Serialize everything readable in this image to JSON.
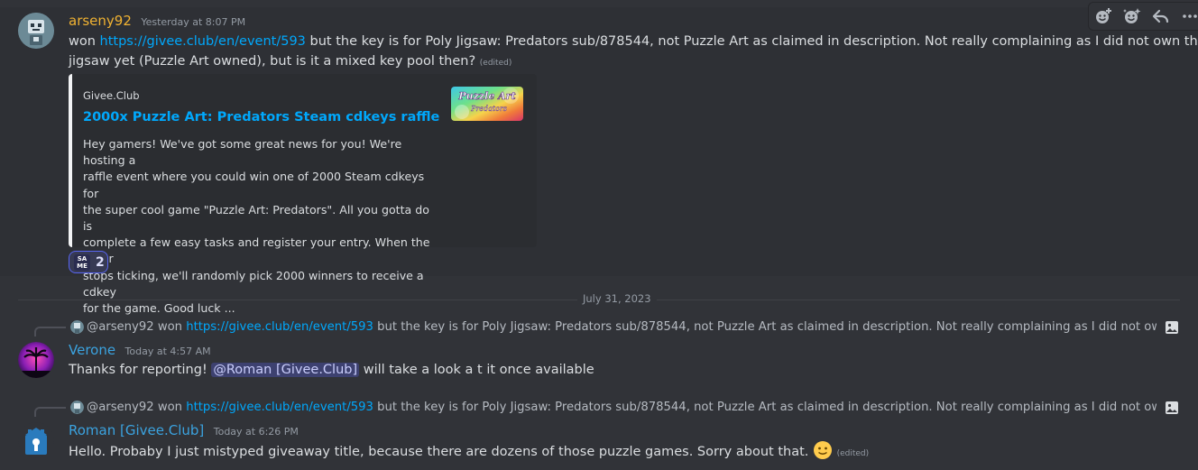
{
  "message1": {
    "username": "arseny92",
    "username_color": "#f0b232",
    "timestamp": "Yesterday at 8:07 PM",
    "text_start": "won ",
    "link": "https://givee.club/en/event/593",
    "text_end_line1": " but the key is for Poly Jigsaw: Predators sub/878544, not Puzzle Art as claimed in description. Not really complaining as I did not own this",
    "text_line2": "jigsaw yet (Puzzle Art owned), but is it a mixed key pool then? ",
    "edited": "(edited)",
    "toolbar_icons": [
      "add-reaction-icon",
      "add-super-reaction-icon",
      "reply-icon",
      "more-icon"
    ],
    "embed": {
      "provider": "Givee.Club",
      "title": "2000x Puzzle Art: Predators Steam cdkeys raffle",
      "description_lines": [
        "Hey gamers! We've got some great news for you! We're hosting a",
        "raffle event where you could win one of 2000 Steam cdkeys for",
        "the super cool game \"Puzzle Art: Predators\". All you gotta do is",
        "complete a few easy tasks and register your entry. When the timer",
        "stops ticking, we'll randomly pick 2000 winners to receive a cdkey",
        "for the game. Good luck ..."
      ],
      "thumbnail_title_line1": "Puzzle Art",
      "thumbnail_title_line2": "Predators"
    },
    "reaction": {
      "emoji_top": "SA",
      "emoji_bottom": "ME",
      "count": "2"
    }
  },
  "divider": {
    "date": "July 31, 2023"
  },
  "message2": {
    "reply": {
      "mention": "@arseny92",
      "text_before_link": " won ",
      "link": "https://givee.club/en/event/593",
      "text_after_link": " but the key is for Poly Jigsaw: Predators sub/878544, not Puzzle Art as claimed in description. Not really complaining as I did not own this jigsaw yet (Pu"
    },
    "username": "Verone",
    "username_color": "#3ba3e0",
    "timestamp": "Today at 4:57 AM",
    "text_before": "Thanks for reporting! ",
    "mention": "@Roman [Givee.Club]",
    "text_after": " will take a look a t it once available"
  },
  "message3": {
    "reply": {
      "mention": "@arseny92",
      "text_before_link": " won ",
      "link": "https://givee.club/en/event/593",
      "text_after_link": " but the key is for Poly Jigsaw: Predators sub/878544, not Puzzle Art as claimed in description. Not really complaining as I did not own this jigsaw yet (Pu"
    },
    "username": "Roman [Givee.Club]",
    "username_color": "#3ba3e0",
    "timestamp": "Today at 6:26 PM",
    "text": "Hello. Probaby I just mistyped giveaway title, because there are dozens of those puzzle games. Sorry about that. ",
    "emoji": "slightly-smiling-face",
    "edited": "(edited)"
  }
}
